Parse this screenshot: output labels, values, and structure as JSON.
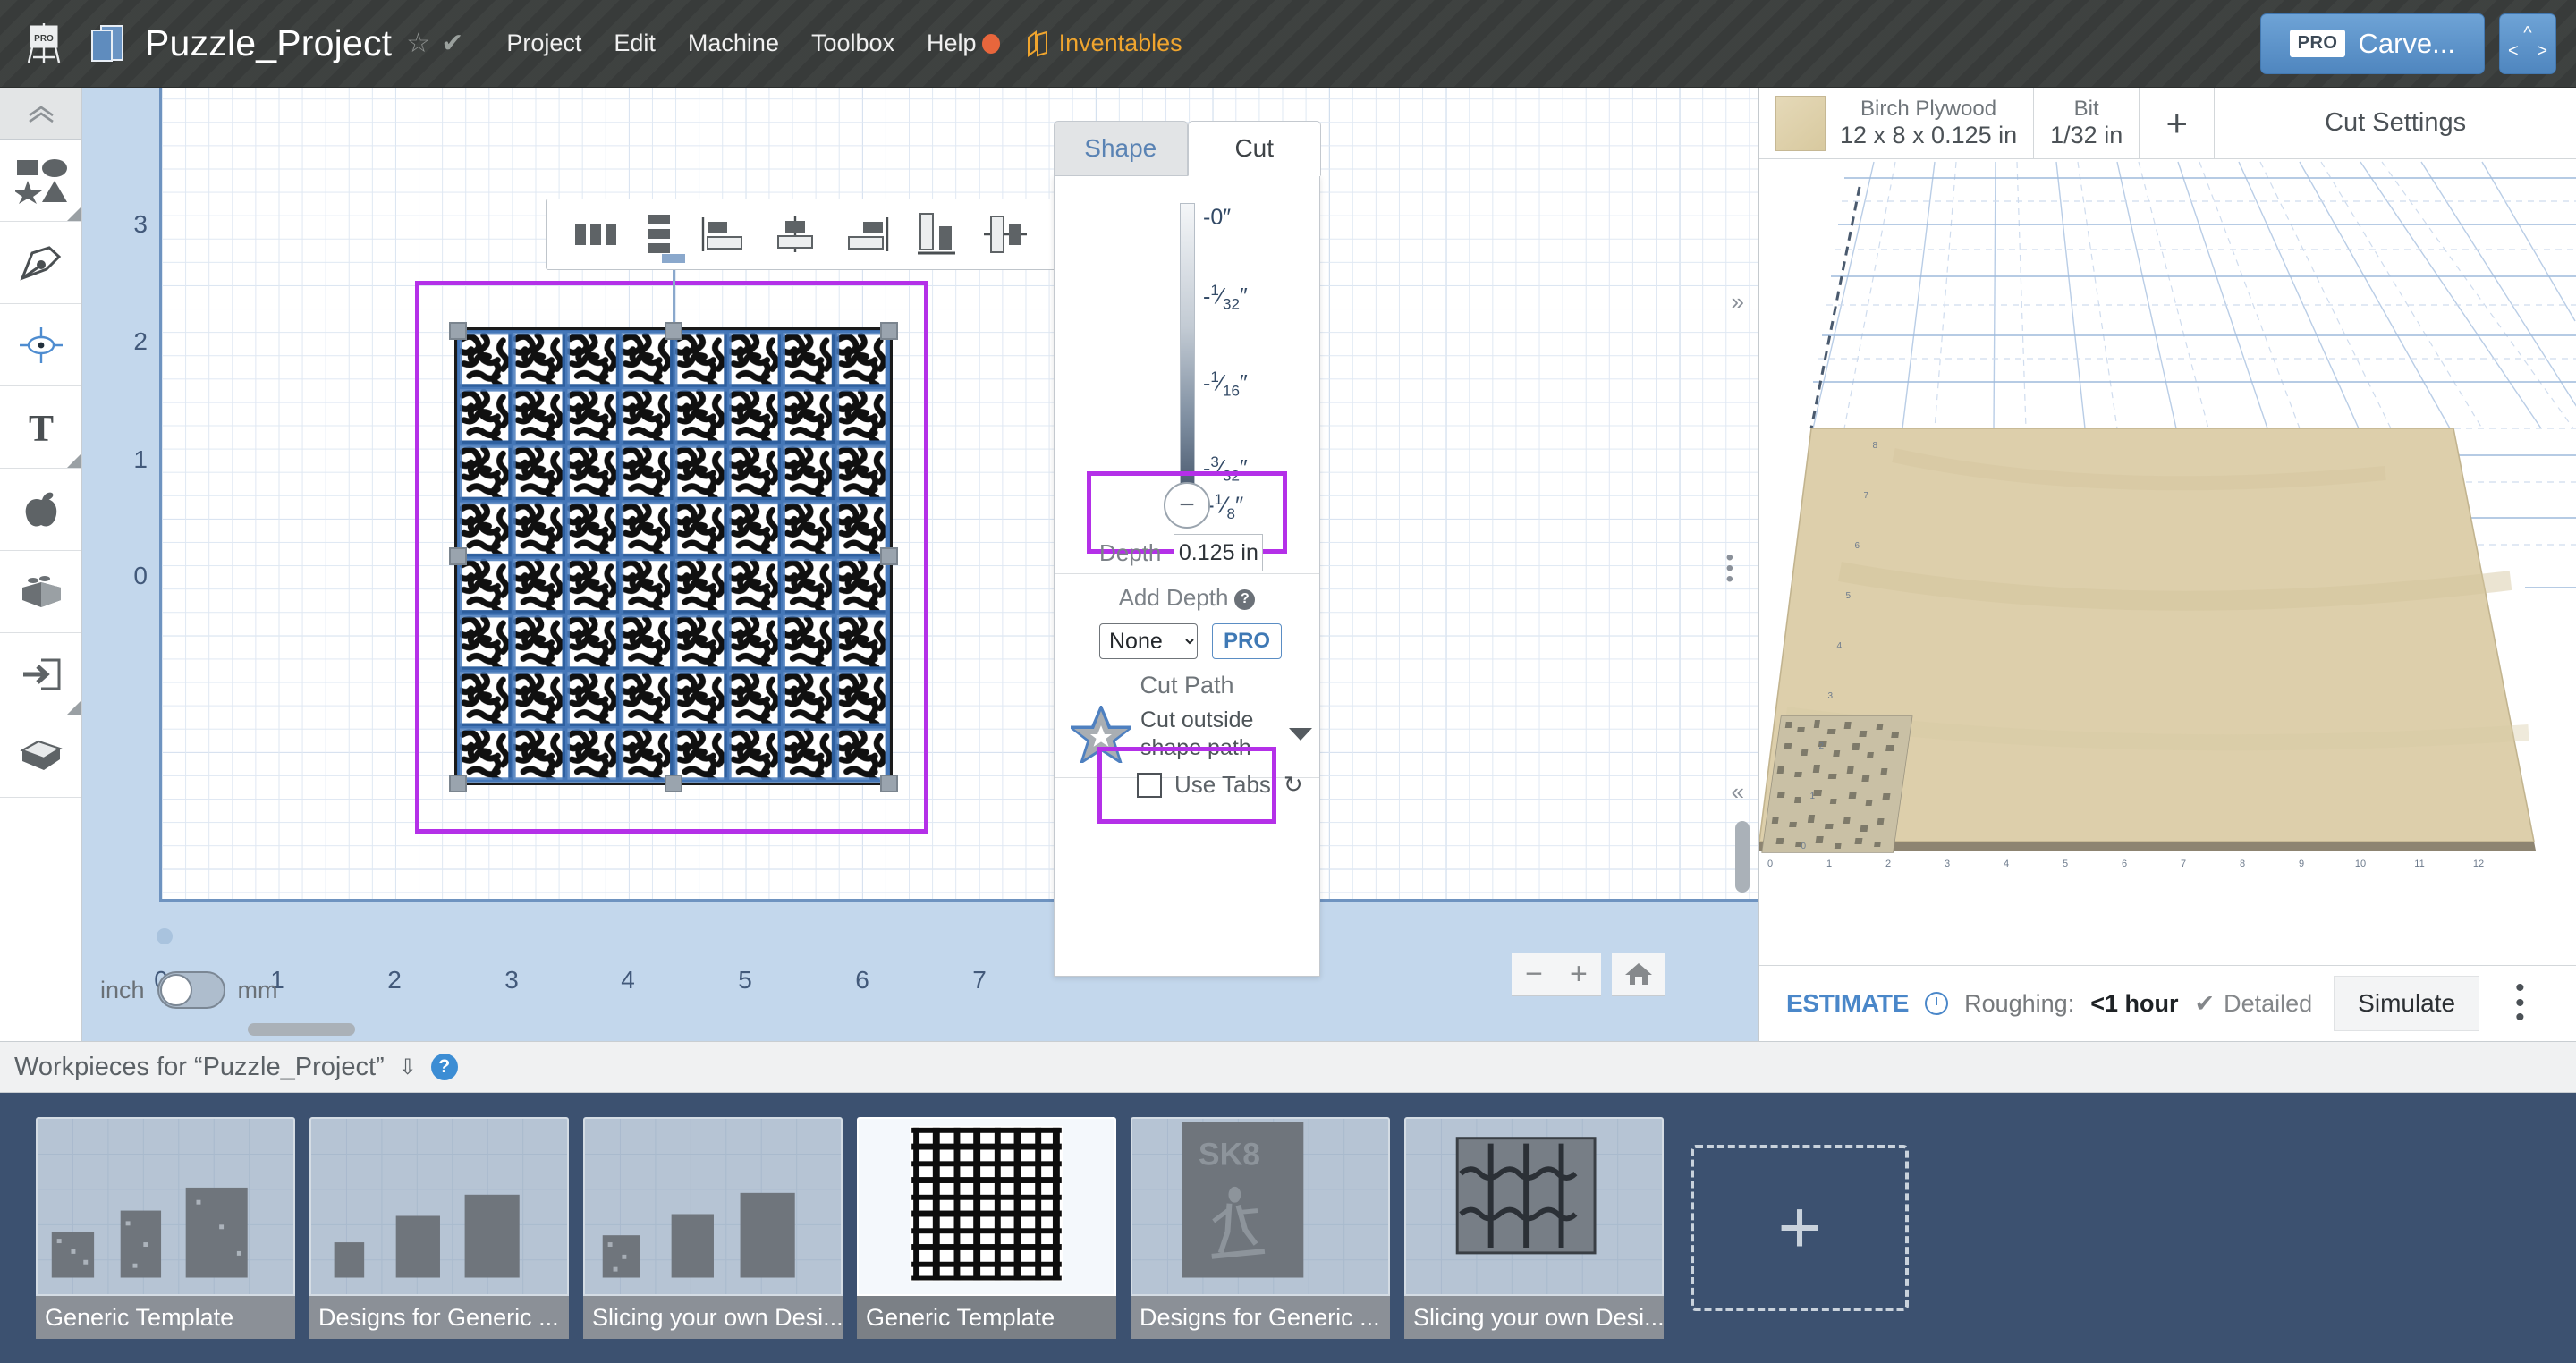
{
  "topbar": {
    "pro_icon": "pro-easel-icon",
    "project_title": "Puzzle_Project",
    "star_icon": "star-outline-icon",
    "saved_icon": "check-icon",
    "menus": [
      "Project",
      "Edit",
      "Machine",
      "Toolbox",
      "Help"
    ],
    "help_dot_color": "#e8663c",
    "brand": "Inventables",
    "brand_color": "#f0a52e",
    "carve_button": {
      "badge": "PRO",
      "label": "Carve..."
    },
    "nav_button_icon": "directional-pad-icon"
  },
  "left_toolbar": {
    "collapse_icon": "chevron-double-up-icon",
    "items": [
      {
        "icon": "shapes-icon",
        "name": "shapes-tool"
      },
      {
        "icon": "pen-tool-icon",
        "name": "pen-tool"
      },
      {
        "icon": "origin-target-icon",
        "name": "origin-tool"
      },
      {
        "icon": "text-tool-icon",
        "name": "text-tool"
      },
      {
        "icon": "apple-icon",
        "name": "apps-tool"
      },
      {
        "icon": "brick-icon",
        "name": "lego-tool"
      },
      {
        "icon": "import-icon",
        "name": "import-tool"
      },
      {
        "icon": "box-3d-icon",
        "name": "three-d-tool"
      }
    ]
  },
  "align_toolbar": {
    "tools": [
      "distribute-horizontal",
      "distribute-vertical",
      "align-left",
      "align-center-horizontal",
      "align-right",
      "align-bottom",
      "align-middle-vertical",
      "align-top"
    ]
  },
  "canvas": {
    "unit_left": "inch",
    "unit_right": "mm",
    "toggle_state": "inch",
    "y_ticks": [
      "3",
      "2",
      "1",
      "0"
    ],
    "x_ticks": [
      "0",
      "1",
      "2",
      "3",
      "4",
      "5",
      "6",
      "7"
    ],
    "origin_label": "0",
    "zoom_out_icon": "minus-icon",
    "zoom_in_icon": "plus-icon",
    "home_icon": "home-icon",
    "selection_color": "#b430e8"
  },
  "cut_panel": {
    "tabs": [
      {
        "label": "Shape",
        "active": false
      },
      {
        "label": "Cut",
        "active": true
      }
    ],
    "slider_ticks": [
      {
        "whole": "-0",
        "num": "",
        "den": "",
        "unit": "″"
      },
      {
        "whole": "-",
        "num": "1",
        "den": "32",
        "unit": "″"
      },
      {
        "whole": "-",
        "num": "1",
        "den": "16",
        "unit": "″"
      },
      {
        "whole": "-",
        "num": "3",
        "den": "32",
        "unit": "″"
      }
    ],
    "knob_icon": "minus-icon",
    "knob_value": {
      "whole": "-",
      "num": "1",
      "den": "8",
      "unit": "″"
    },
    "depth_label": "Depth",
    "depth_value": "0.125 in",
    "add_depth_label": "Add Depth",
    "add_depth_help_icon": "question-mark-icon",
    "add_depth_value": "None",
    "add_depth_options": [
      "None"
    ],
    "pro_badge": "PRO",
    "cut_path_title": "Cut Path",
    "cut_path_icon": "star-outline-icon",
    "cut_path_value": "Cut outside shape path",
    "cut_path_caret": "chevron-down-icon",
    "use_tabs_label": "Use Tabs",
    "use_tabs_checked": false,
    "use_tabs_refresh_icon": "refresh-icon"
  },
  "right_panel": {
    "material": {
      "name": "Birch Plywood",
      "dimensions": "12 x 8 x 0.125 in"
    },
    "bit": {
      "label": "Bit",
      "value": "1/32 in"
    },
    "add_icon": "plus-icon",
    "cut_settings_label": "Cut Settings",
    "preview": {
      "x_ticks": [
        "0",
        "1",
        "2",
        "3",
        "4",
        "5",
        "6",
        "7",
        "8",
        "9",
        "10",
        "11",
        "12"
      ],
      "y_ticks": [
        "0",
        "1",
        "2",
        "3",
        "4",
        "5",
        "6",
        "7",
        "8"
      ]
    },
    "estimate": {
      "label": "ESTIMATE",
      "clock_icon": "clock-icon",
      "roughing_label": "Roughing:",
      "roughing_value": "<1 hour",
      "detail_check_icon": "check-icon",
      "detail_label": "Detailed",
      "simulate_label": "Simulate",
      "more_icon": "kebab-menu-icon"
    }
  },
  "workpieces": {
    "header": "Workpieces for “Puzzle_Project”",
    "expand_icon": "chevron-double-down-icon",
    "help_icon": "question-mark-icon",
    "add_icon": "plus-icon",
    "cards": [
      {
        "label": "Generic Template",
        "selected": false,
        "thumb": "three-bars-puzzle"
      },
      {
        "label": "Designs for Generic ...",
        "selected": false,
        "thumb": "small-puzzle-bars"
      },
      {
        "label": "Slicing your own Desi...",
        "selected": false,
        "thumb": "small-puzzle-bars"
      },
      {
        "label": "Generic Template",
        "selected": true,
        "thumb": "puzzle-grid"
      },
      {
        "label": "Designs for Generic ...",
        "selected": false,
        "thumb": "sk8-panel"
      },
      {
        "label": "Slicing your own Desi...",
        "selected": false,
        "thumb": "puzzle-pieces"
      }
    ]
  }
}
